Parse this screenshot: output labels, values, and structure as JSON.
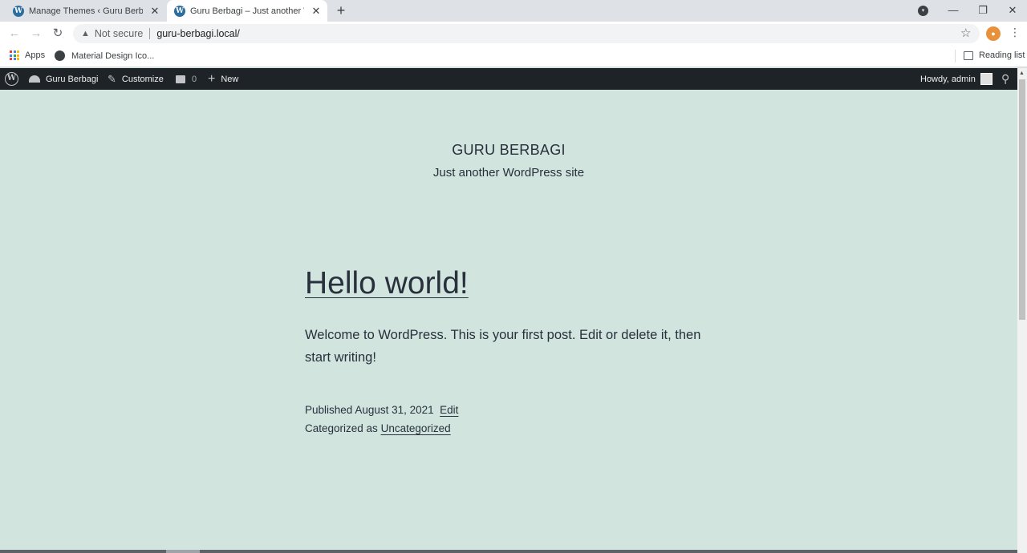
{
  "browser": {
    "tabs": [
      {
        "title": "Manage Themes ‹ Guru Berbagi",
        "favicon": "wordpress-icon",
        "active": false
      },
      {
        "title": "Guru Berbagi – Just another Wor",
        "favicon": "wordpress-icon",
        "active": true
      }
    ],
    "new_tab": "+",
    "address": {
      "security": "Not secure",
      "url": "guru-berbagi.local/"
    },
    "bookmarks": [
      {
        "label": "Apps",
        "icon": "apps-grid-icon"
      },
      {
        "label": "Material Design Ico...",
        "icon": "globe-icon"
      }
    ],
    "reading_list": "Reading list"
  },
  "adminbar": {
    "site_name": "Guru Berbagi",
    "customize": "Customize",
    "comments": "0",
    "new": "New",
    "howdy": "Howdy, admin"
  },
  "site": {
    "title": "GURU BERBAGI",
    "description": "Just another WordPress site"
  },
  "post": {
    "title": "Hello world!",
    "body": "Welcome to WordPress. This is your first post. Edit or delete it, then start writing!",
    "published_label": "Published",
    "published_date": "August 31, 2021",
    "edit_label": "Edit",
    "categorized_label": "Categorized as",
    "category": "Uncategorized"
  }
}
